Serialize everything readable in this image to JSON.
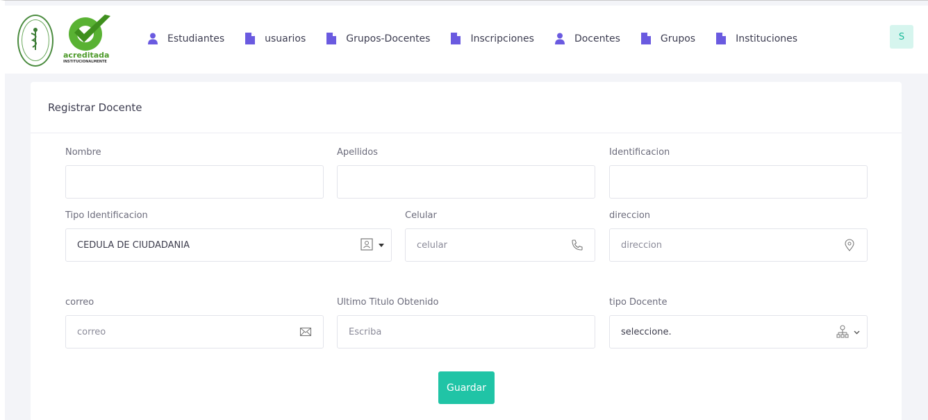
{
  "header": {
    "logo_text": "acreditada",
    "logo_subtext": "INSTITUCIONALMENTE",
    "nav": [
      {
        "label": "Estudiantes",
        "icon": "user-icon"
      },
      {
        "label": "usuarios",
        "icon": "file-icon"
      },
      {
        "label": "Grupos-Docentes",
        "icon": "file-icon"
      },
      {
        "label": "Inscripciones",
        "icon": "file-icon"
      },
      {
        "label": "Docentes",
        "icon": "user-icon"
      },
      {
        "label": "Grupos",
        "icon": "file-icon"
      },
      {
        "label": "Instituciones",
        "icon": "file-icon"
      }
    ],
    "avatar_initial": "S"
  },
  "form": {
    "title": "Registrar Docente",
    "nombre": {
      "label": "Nombre",
      "value": "",
      "placeholder": ""
    },
    "apellidos": {
      "label": "Apellidos",
      "value": "",
      "placeholder": ""
    },
    "identificacion": {
      "label": "Identificacion",
      "value": "",
      "placeholder": ""
    },
    "tipo_identificacion": {
      "label": "Tipo Identificacion",
      "selected": "CEDULA DE CIUDADANIA",
      "icon": "id-card-icon"
    },
    "celular": {
      "label": "Celular",
      "placeholder": "celular",
      "icon": "phone-icon"
    },
    "direccion": {
      "label": "direccion",
      "placeholder": "direccion",
      "icon": "map-pin-icon"
    },
    "correo": {
      "label": "correo",
      "placeholder": "correo",
      "icon": "envelope-icon"
    },
    "titulo": {
      "label": "Ultimo Titulo Obtenido",
      "placeholder": "Escriba"
    },
    "tipo_docente": {
      "label": "tipo Docente",
      "selected": "seleccione.",
      "icon": "hierarchy-icon"
    },
    "save_label": "Guardar"
  },
  "colors": {
    "accent": "#20c4a6",
    "nav_icon": "#6a5ae0"
  }
}
